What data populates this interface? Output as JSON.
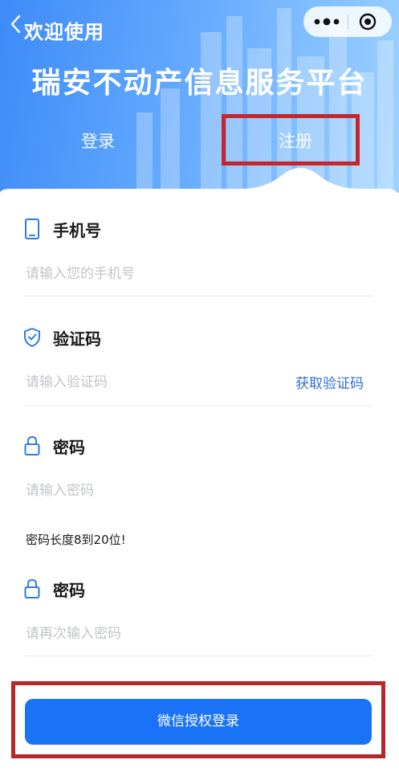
{
  "nav": {
    "back_icon": "chevron-left-icon",
    "title": "欢迎使用"
  },
  "capsule": {
    "more_icon": "more-dots-icon",
    "close_icon": "target-circle-icon"
  },
  "app_title": "瑞安不动产信息服务平台",
  "tabs": [
    {
      "label": "登录",
      "active": false
    },
    {
      "label": "注册",
      "active": true
    }
  ],
  "form": {
    "phone": {
      "icon": "phone-icon",
      "label": "手机号",
      "placeholder": "请输入您的手机号",
      "value": ""
    },
    "code": {
      "icon": "shield-check-icon",
      "label": "验证码",
      "placeholder": "请输入验证码",
      "value": "",
      "action": "获取验证码"
    },
    "password": {
      "icon": "lock-icon",
      "label": "密码",
      "placeholder": "请输入密码",
      "value": ""
    },
    "password_hint": "密码长度8到20位!",
    "password_confirm": {
      "icon": "lock-icon",
      "label": "密码",
      "placeholder": "请再次输入密码",
      "value": ""
    }
  },
  "submit_label": "微信授权登录",
  "colors": {
    "header_gradient": [
      "#3d8bf7",
      "#9fd3ff"
    ],
    "accent": "#1a73f6",
    "link": "#2f6fd8",
    "icon": "#2f7be6",
    "highlight_box": "#c3272a"
  }
}
